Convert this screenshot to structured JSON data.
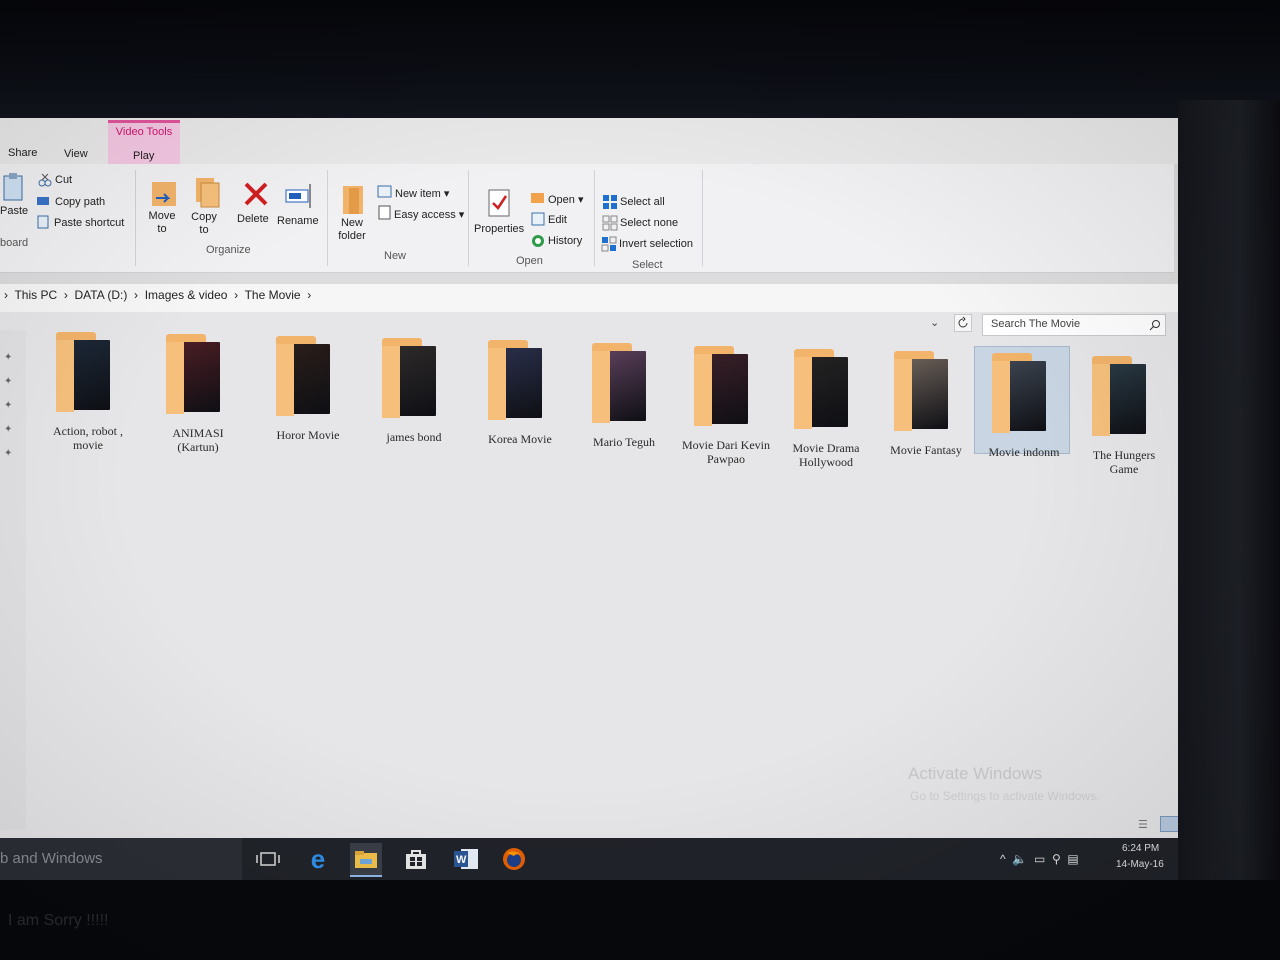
{
  "ribbon": {
    "tabs": [
      "Share",
      "View",
      "Play"
    ],
    "context_title": "Video Tools",
    "clipboard": {
      "paste": "Paste",
      "cut": "Cut",
      "copy_path": "Copy path",
      "paste_shortcut": "Paste shortcut",
      "group": "board"
    },
    "organize": {
      "move_to": "Move",
      "move_to2": "to",
      "copy_to": "Copy",
      "copy_to2": "to",
      "delete": "Delete",
      "rename": "Rename",
      "group": "Organize"
    },
    "new": {
      "new_item": "New item",
      "easy_access": "Easy access",
      "new_folder": "New",
      "new_folder2": "folder",
      "group": "New"
    },
    "open": {
      "properties": "Properties",
      "open": "Open",
      "edit": "Edit",
      "history": "History",
      "group": "Open"
    },
    "select": {
      "select_all": "Select all",
      "select_none": "Select none",
      "invert_selection": "Invert selection",
      "group": "Select"
    }
  },
  "breadcrumb": [
    "This PC",
    "DATA (D:)",
    "Images & video",
    "The Movie"
  ],
  "search": {
    "placeholder": "Search The Movie"
  },
  "folders": [
    {
      "line1": "Action, robot ,",
      "line2": "movie",
      "poster": "#1c2838"
    },
    {
      "line1": "ANIMASI",
      "line2": "(Kartun)",
      "poster": "#4a1d24"
    },
    {
      "line1": "Horor Movie",
      "line2": "",
      "poster": "#2a1e1a"
    },
    {
      "line1": "james bond",
      "line2": "",
      "poster": "#2e2a2a"
    },
    {
      "line1": "Korea Movie",
      "line2": "",
      "poster": "#2a2f4a"
    },
    {
      "line1": "Mario Teguh",
      "line2": "",
      "poster": "#5a3f5a"
    },
    {
      "line1": "Movie Dari Kevin",
      "line2": "Pawpao",
      "poster": "#3a1f28"
    },
    {
      "line1": "Movie Drama",
      "line2": "Hollywood",
      "poster": "#242222"
    },
    {
      "line1": "Movie Fantasy",
      "line2": "",
      "poster": "#6a5f58"
    },
    {
      "line1": "Movie indonm",
      "line2": "",
      "poster": "#3c4450"
    },
    {
      "line1": "The Hungers",
      "line2": "Game",
      "poster": "#2a3a44"
    }
  ],
  "watermark": {
    "title": "Activate Windows",
    "subtitle": "Go to Settings to activate Windows."
  },
  "taskbar": {
    "search_text": "b and Windows",
    "time": "6:24 PM",
    "date": "14-May-16"
  },
  "bezel_text": "I am Sorry !!!!!",
  "colors": {
    "folder": "#f2b36a",
    "context_tab": "#e1559b",
    "taskbar": "#202329"
  }
}
